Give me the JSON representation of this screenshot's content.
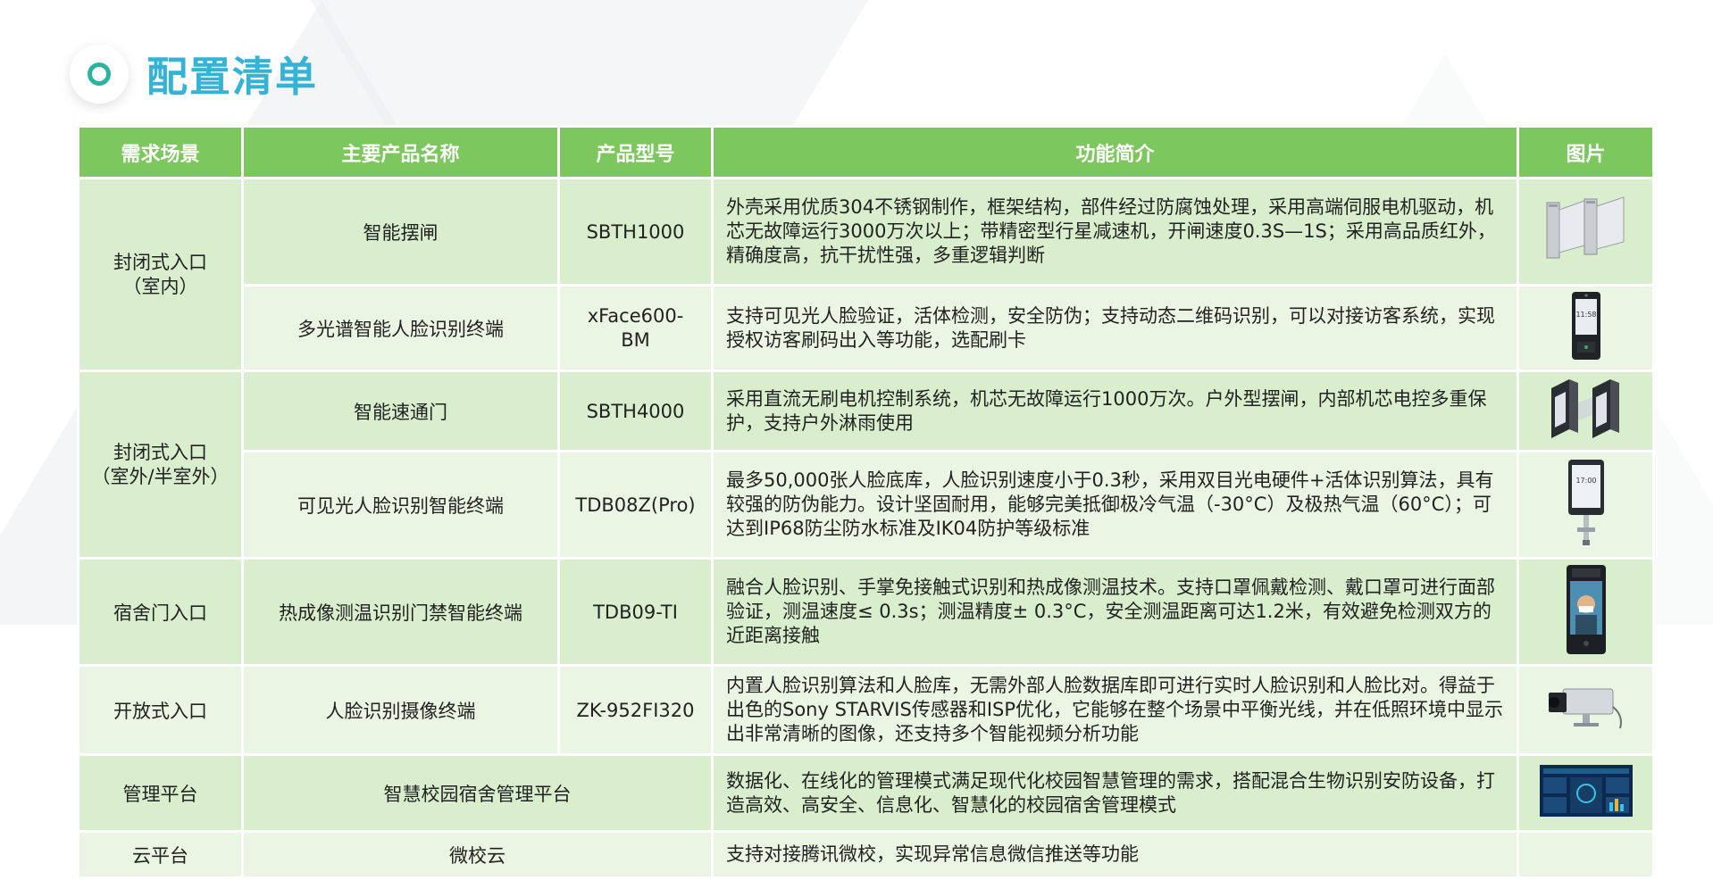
{
  "title": "配置清单",
  "colors": {
    "header_bg": "#7dc75f",
    "row_dark": "#d9eecd",
    "row_light": "#eaf6e3",
    "title": "#34b3d6"
  },
  "table": {
    "headers": [
      "需求场景",
      "主要产品名称",
      "产品型号",
      "功能简介",
      "图片"
    ],
    "rows": [
      {
        "scene_line1": "封闭式入口",
        "scene_line2": "（室内）",
        "name": "智能摆闸",
        "model": "SBTH1000",
        "desc": "外壳采用优质304不锈钢制作，框架结构，部件经过防腐蚀处理，采用高端伺服电机驱动，机芯无故障运行3000万次以上；带精密型行星减速机，开闸速度0.3S—1S；采用高品质红外，精确度高，抗干扰性强，多重逻辑判断",
        "icon": "swing-gate-icon"
      },
      {
        "name": "多光谱智能人脸识别终端",
        "model": "xFace600-BM",
        "desc": "支持可见光人脸验证，活体检测，安全防伪；支持动态二维码识别，可以对接访客系统，实现授权访客刷码出入等功能，选配刷卡",
        "icon": "face-terminal-icon",
        "screen_time": "11:58"
      },
      {
        "scene_line1": "封闭式入口",
        "scene_line2": "（室外/半室外）",
        "name": "智能速通门",
        "model": "SBTH4000",
        "desc": "采用直流无刷电机控制系统，机芯无故障运行1000万次。户外型摆闸，内部机芯电控多重保护，支持户外淋雨使用",
        "icon": "speed-gate-icon"
      },
      {
        "name": "可见光人脸识别智能终端",
        "model": "TDB08Z(Pro)",
        "desc": "最多50,000张人脸底库，人脸识别速度小于0.3秒，采用双目光电硬件+活体识别算法，具有较强的防伪能力。设计坚固耐用，能够完美抵御极冷气温（-30°C）及极热气温（60°C）；可达到IP68防尘防水标准及IK04防护等级标准",
        "icon": "pole-terminal-icon",
        "screen_time": "17:00"
      },
      {
        "scene": "宿舍门入口",
        "name": "热成像测温识别门禁智能终端",
        "model": "TDB09-TI",
        "desc": "融合人脸识别、手掌免接触式识别和热成像测温技术。支持口罩佩戴检测、戴口罩可进行面部验证，测温速度≤ 0.3s；测温精度± 0.3°C，安全测温距离可达1.2米，有效避免检测双方的近距离接触",
        "icon": "thermal-terminal-icon"
      },
      {
        "scene": "开放式入口",
        "name": "人脸识别摄像终端",
        "model": "ZK-952FI320",
        "desc": "内置人脸识别算法和人脸库，无需外部人脸数据库即可进行实时人脸识别和人脸比对。得益于出色的Sony STARVIS传感器和ISP优化，它能够在整个场景中平衡光线，并在低照环境中显示出非常清晰的图像，还支持多个智能视频分析功能",
        "icon": "camera-icon"
      },
      {
        "scene": "管理平台",
        "name": "智慧校园宿舍管理平台",
        "desc": "数据化、在线化的管理模式满足现代化校园智慧管理的需求，搭配混合生物识别安防设备，打造高效、高安全、信息化、智慧化的校园宿舍管理模式",
        "icon": "dashboard-icon"
      },
      {
        "scene": "云平台",
        "name": "微校云",
        "desc": "支持对接腾讯微校，实现异常信息微信推送等功能"
      }
    ]
  }
}
